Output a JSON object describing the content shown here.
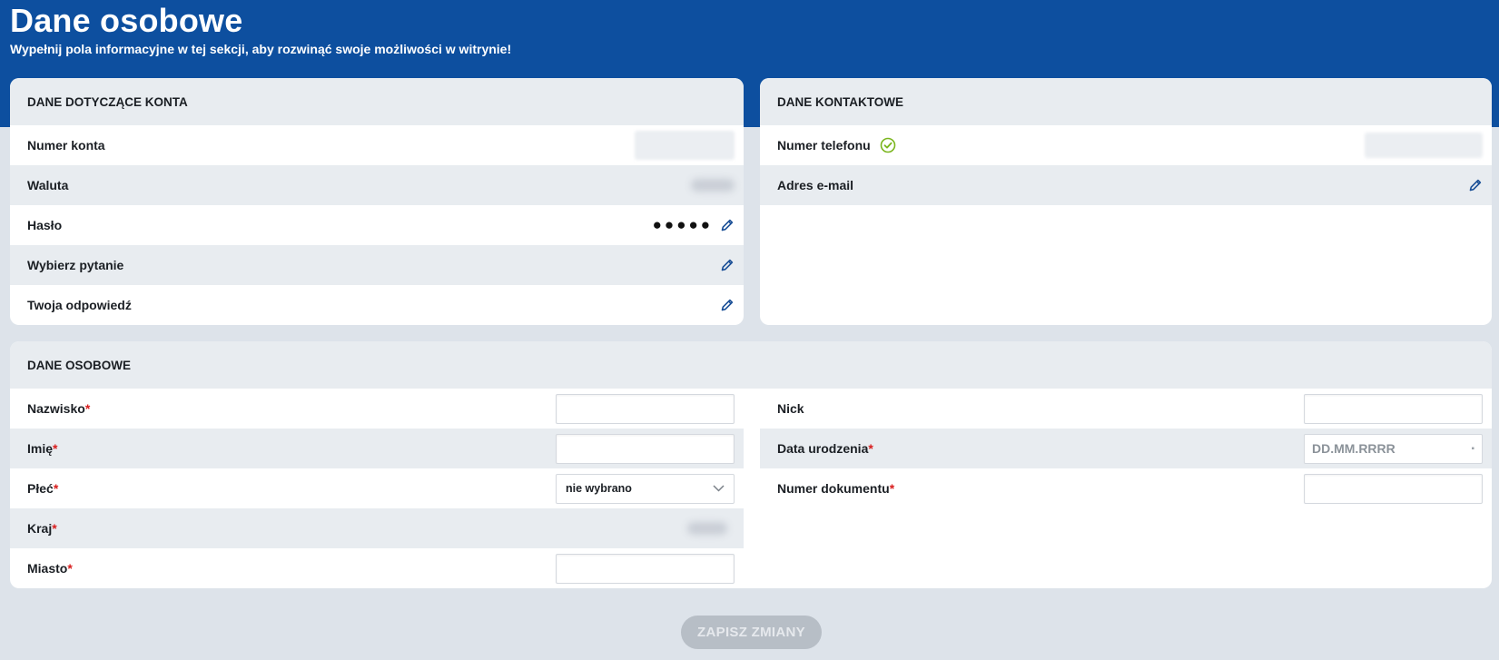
{
  "header": {
    "title": "Dane osobowe",
    "subtitle": "Wypełnij pola informacyjne w tej sekcji, aby rozwinąć swoje możliwości w witrynie!"
  },
  "account": {
    "heading": "DANE DOTYCZĄCE KONTA",
    "account_number_label": "Numer konta",
    "currency_label": "Waluta",
    "password_label": "Hasło",
    "password_value": "●●●●●",
    "question_label": "Wybierz pytanie",
    "answer_label": "Twoja odpowiedź"
  },
  "contact": {
    "heading": "DANE KONTAKTOWE",
    "phone_label": "Numer telefonu",
    "email_label": "Adres e-mail"
  },
  "personal": {
    "heading": "DANE OSOBOWE",
    "surname_label": "Nazwisko",
    "name_label": "Imię",
    "gender_label": "Płeć",
    "gender_value": "nie wybrano",
    "country_label": "Kraj",
    "city_label": "Miasto",
    "nick_label": "Nick",
    "birthdate_label": "Data urodzenia",
    "birthdate_placeholder": "DD.MM.RRRR",
    "document_label": "Numer dokumentu",
    "required_mark": "*"
  },
  "actions": {
    "save_label": "ZAPISZ ZMIANY"
  },
  "colors": {
    "brand_blue": "#0d4f9f",
    "icon_blue": "#1a4f96",
    "verified_green": "#7ab51d",
    "required_red": "#d81d1d"
  },
  "icons": {
    "edit": "pencil-icon",
    "verified": "check-circle-icon",
    "select": "chevron-down-icon"
  }
}
